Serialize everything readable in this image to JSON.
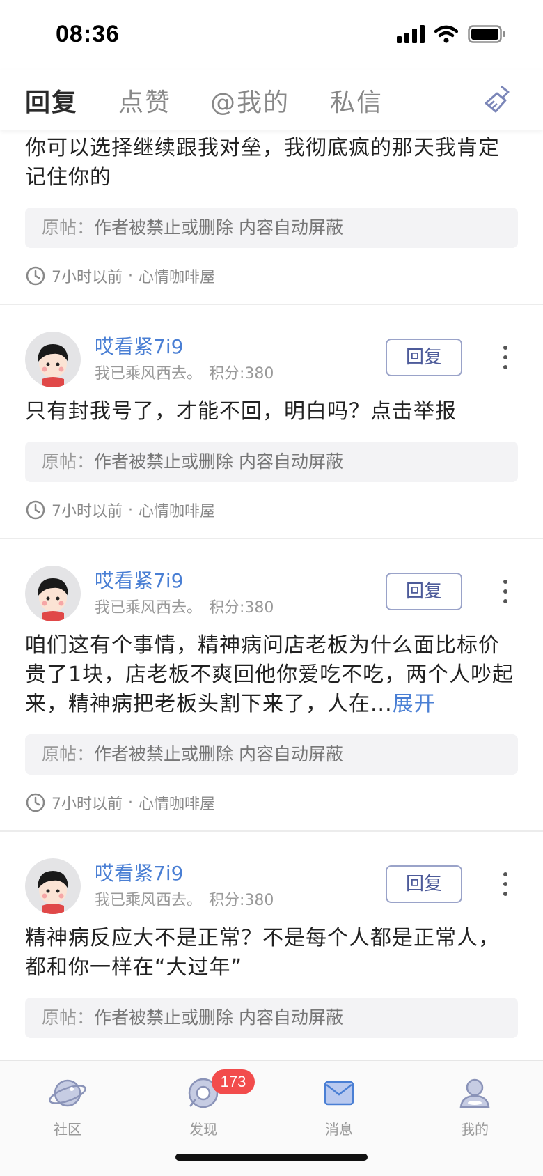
{
  "status_bar": {
    "time": "08:36"
  },
  "tabs": [
    {
      "label": "回复",
      "active": true
    },
    {
      "label": "点赞",
      "active": false
    },
    {
      "label": "@我的",
      "active": false
    },
    {
      "label": "私信",
      "active": false
    }
  ],
  "header_actions": {
    "clear_icon": "broom-icon"
  },
  "items": [
    {
      "content": "你可以选择继续跟我对垒，我彻底疯的那天我肯定记住你的",
      "original_label": "原帖：",
      "original_text": "作者被禁止或删除 内容自动屏蔽",
      "time": "7小时以前",
      "forum": "心情咖啡屋"
    },
    {
      "username": "哎看紧7i9",
      "signature": "我已乘风西去。",
      "score": "积分:380",
      "reply_label": "回复",
      "content": "只有封我号了，才能不回，明白吗？点击举报",
      "original_label": "原帖：",
      "original_text": "作者被禁止或删除 内容自动屏蔽",
      "time": "7小时以前",
      "forum": "心情咖啡屋"
    },
    {
      "username": "哎看紧7i9",
      "signature": "我已乘风西去。",
      "score": "积分:380",
      "reply_label": "回复",
      "content": "咱们这有个事情，精神病问店老板为什么面比标价贵了1块，店老板不爽回他你爱吃不吃，两个人吵起来，精神病把老板头割下来了，人在...",
      "expand_label": "展开",
      "original_label": "原帖：",
      "original_text": "作者被禁止或删除 内容自动屏蔽",
      "time": "7小时以前",
      "forum": "心情咖啡屋"
    },
    {
      "username": "哎看紧7i9",
      "signature": "我已乘风西去。",
      "score": "积分:380",
      "reply_label": "回复",
      "content": "精神病反应大不是正常？不是每个人都是正常人，都和你一样在“大过年”",
      "original_label": "原帖：",
      "original_text": "作者被禁止或删除 内容自动屏蔽"
    }
  ],
  "meta_separator": "·",
  "bottom_nav": [
    {
      "label": "社区",
      "icon": "planet-icon",
      "active": false
    },
    {
      "label": "发现",
      "icon": "discover-icon",
      "active": false,
      "badge": "173"
    },
    {
      "label": "消息",
      "icon": "mail-icon",
      "active": true
    },
    {
      "label": "我的",
      "icon": "profile-icon",
      "active": false
    }
  ],
  "colors": {
    "accent": "#4a7fd4",
    "badge": "#f24c4c",
    "reply_border": "#9aa3c9"
  }
}
